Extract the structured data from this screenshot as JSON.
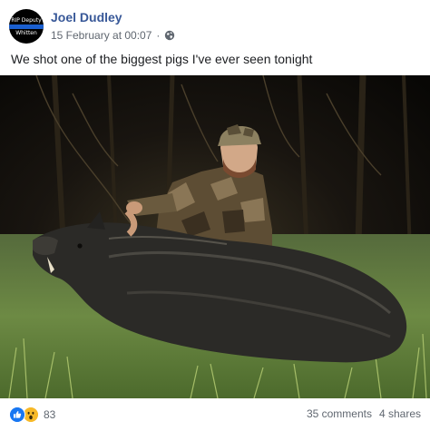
{
  "post": {
    "author": "Joel Dudley",
    "avatar_text_top": "RIP Deputy",
    "avatar_text_bottom": "Whitten",
    "date": "15 February at 00:07",
    "privacy_icon": "globe-icon",
    "caption": "We shot one of the biggest pigs I've ever seen tonight"
  },
  "photo": {
    "icon": "photo-image"
  },
  "footer": {
    "reaction_icons": [
      "like-icon",
      "wow-icon"
    ],
    "reaction_count": "83",
    "comments": "35 comments",
    "shares": "4 shares"
  },
  "colors": {
    "name": "#385898",
    "meta": "#606770",
    "text": "#1c1e21",
    "like": "#1877f2",
    "wow": "#f7b928"
  }
}
